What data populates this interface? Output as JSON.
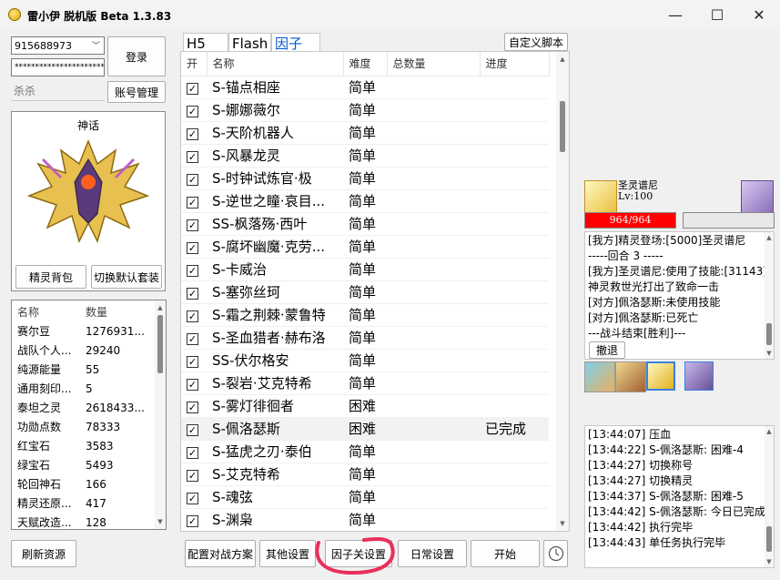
{
  "window": {
    "title": "雷小伊 脱机版 Beta 1.3.83",
    "controls": {
      "minimize": "—",
      "maximize": "☐",
      "close": "✕"
    }
  },
  "login": {
    "account": "915688973",
    "password": "****************************",
    "nickname": "",
    "nickname_placeholder": "杀杀",
    "login_button": "登录",
    "account_manage_button": "账号管理"
  },
  "spirit_card": {
    "title": "神话",
    "backpack_button": "精灵背包",
    "switch_suit_button": "切换默认套装"
  },
  "resources": {
    "headers": [
      "名称",
      "数量"
    ],
    "rows": [
      [
        "赛尔豆",
        "1276931..."
      ],
      [
        "战队个人...",
        "29240"
      ],
      [
        "纯源能量",
        "55"
      ],
      [
        "通用刻印...",
        "5"
      ],
      [
        "泰坦之灵",
        "2618433..."
      ],
      [
        "功勋点数",
        "78333"
      ],
      [
        "红宝石",
        "3583"
      ],
      [
        "绿宝石",
        "5493"
      ],
      [
        "轮回神石",
        "166"
      ],
      [
        "精灵还原...",
        "417"
      ],
      [
        "天赋改造...",
        "128"
      ]
    ],
    "refresh_button": "刷新资源"
  },
  "tabs": [
    "H5",
    "Flash",
    "因子"
  ],
  "custom_script_button": "自定义脚本",
  "factor_table": {
    "headers": [
      "开",
      "名称",
      "难度",
      "总数量",
      "进度"
    ],
    "rows": [
      {
        "checked": true,
        "name": "S-锚点相座",
        "difficulty": "简单",
        "total": "",
        "progress": ""
      },
      {
        "checked": true,
        "name": "S-娜娜薇尔",
        "difficulty": "简单",
        "total": "",
        "progress": ""
      },
      {
        "checked": true,
        "name": "S-天阶机器人",
        "difficulty": "简单",
        "total": "",
        "progress": ""
      },
      {
        "checked": true,
        "name": "S-风暴龙灵",
        "difficulty": "简单",
        "total": "",
        "progress": ""
      },
      {
        "checked": true,
        "name": "S-时钟试炼官·极",
        "difficulty": "简单",
        "total": "",
        "progress": ""
      },
      {
        "checked": true,
        "name": "S-逆世之瞳·哀目...",
        "difficulty": "简单",
        "total": "",
        "progress": ""
      },
      {
        "checked": true,
        "name": "SS-枫落殇·西叶",
        "difficulty": "简单",
        "total": "",
        "progress": ""
      },
      {
        "checked": true,
        "name": "S-腐坏幽魔·克劳...",
        "difficulty": "简单",
        "total": "",
        "progress": ""
      },
      {
        "checked": true,
        "name": "S-卡威治",
        "difficulty": "简单",
        "total": "",
        "progress": ""
      },
      {
        "checked": true,
        "name": "S-塞弥丝珂",
        "difficulty": "简单",
        "total": "",
        "progress": ""
      },
      {
        "checked": true,
        "name": "S-霜之荆棘·蒙鲁特",
        "difficulty": "简单",
        "total": "",
        "progress": ""
      },
      {
        "checked": true,
        "name": "S-圣血猎者·赫布洛",
        "difficulty": "简单",
        "total": "",
        "progress": ""
      },
      {
        "checked": true,
        "name": "SS-伏尔格安",
        "difficulty": "简单",
        "total": "",
        "progress": ""
      },
      {
        "checked": true,
        "name": "S-裂岩·艾克特希",
        "difficulty": "简单",
        "total": "",
        "progress": ""
      },
      {
        "checked": true,
        "name": "S-雾灯徘徊者",
        "difficulty": "困难",
        "total": "",
        "progress": ""
      },
      {
        "checked": true,
        "name": "S-佩洛瑟斯",
        "difficulty": "困难",
        "total": "",
        "progress": "已完成",
        "selected": true
      },
      {
        "checked": true,
        "name": "S-猛虎之刃·泰伯",
        "difficulty": "简单",
        "total": "",
        "progress": ""
      },
      {
        "checked": true,
        "name": "S-艾克特希",
        "difficulty": "简单",
        "total": "",
        "progress": ""
      },
      {
        "checked": true,
        "name": "S-魂弦",
        "difficulty": "简单",
        "total": "",
        "progress": ""
      },
      {
        "checked": true,
        "name": "S-渊枭",
        "difficulty": "简单",
        "total": "",
        "progress": ""
      }
    ]
  },
  "bottom_buttons": {
    "battle_plan": "配置对战方案",
    "other_settings": "其他设置",
    "factor_settings": "因子关设置",
    "daily_settings": "日常设置",
    "start": "开始"
  },
  "battle": {
    "player_name": "圣灵谱尼",
    "player_level": "Lv:100",
    "player_hp_text": "964/964",
    "player_hp_fraction": 1.0,
    "enemy_hp_fraction": 0.0,
    "hp_color": "#ff0000",
    "log": [
      "[我方]精灵登场:[5000]圣灵谱尼",
      "-----回合 3 -----",
      "[我方]圣灵谱尼:使用了技能:[31143]",
      "神灵救世光打出了致命一击",
      "[对方]佩洛瑟斯:未使用技能",
      "[对方]佩洛瑟斯:已死亡",
      "---战斗结束[胜利]---"
    ],
    "retreat_button": "撤退"
  },
  "task_log": [
    "[13:44:07] 压血",
    "[13:44:22] S-佩洛瑟斯:  困难-4",
    "[13:44:27] 切换称号",
    "[13:44:27] 切换精灵",
    "[13:44:37] S-佩洛瑟斯:  困难-5",
    "[13:44:42] S-佩洛瑟斯:  今日已完成",
    "[13:44:42]  执行完毕",
    "[13:44:43] 单任务执行完毕"
  ],
  "annotation_color": "#e8305a"
}
